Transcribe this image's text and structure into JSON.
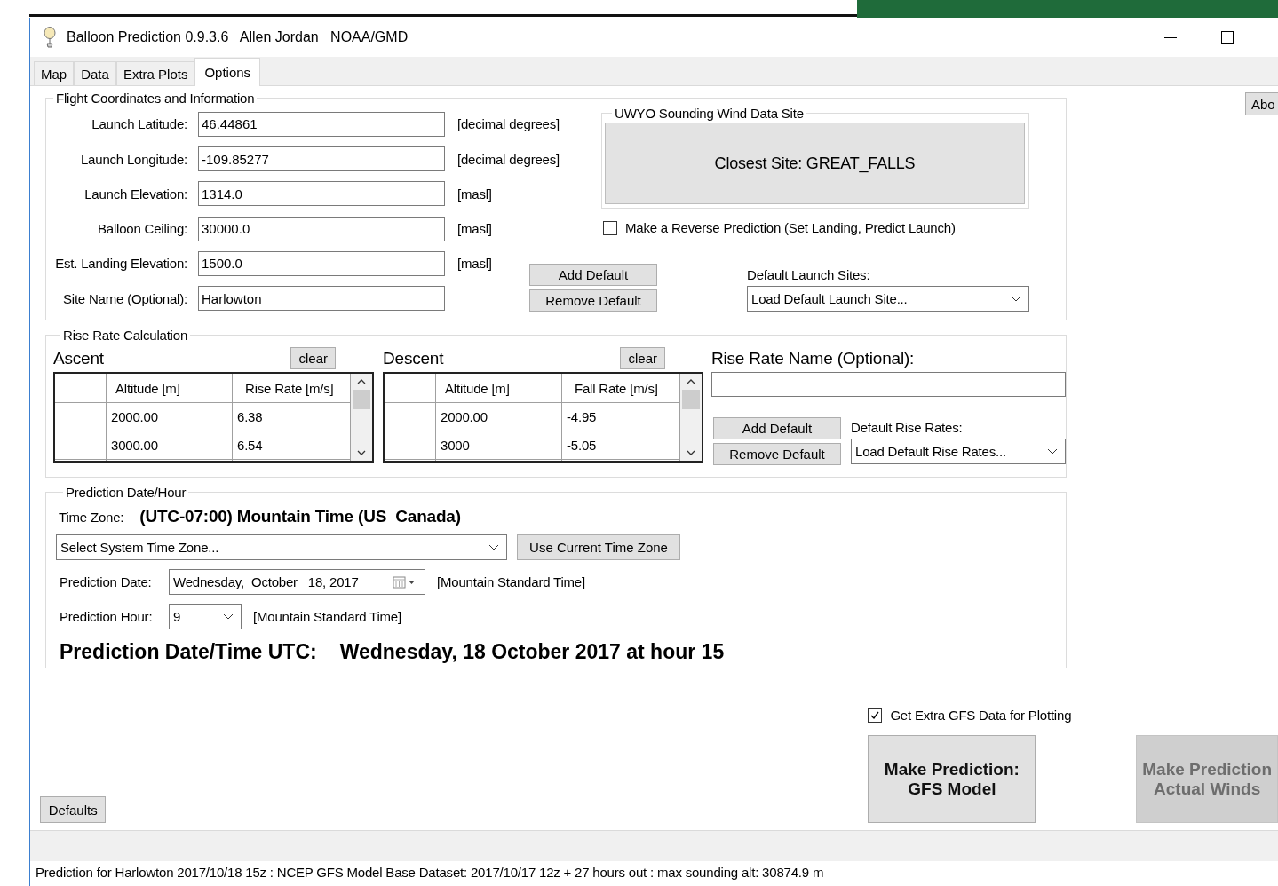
{
  "window": {
    "title": "Balloon Prediction 0.9.3.6   Allen Jordan   NOAA/GMD"
  },
  "tabs": [
    {
      "label": "Map",
      "selected": false
    },
    {
      "label": "Data",
      "selected": false
    },
    {
      "label": "Extra Plots",
      "selected": false
    },
    {
      "label": "Options",
      "selected": true
    }
  ],
  "about_button": "Abo",
  "flight": {
    "title": "Flight Coordinates and Information",
    "fields": [
      {
        "label": "Launch Latitude:",
        "value": "46.44861",
        "unit": "[decimal degrees]"
      },
      {
        "label": "Launch Longitude:",
        "value": "-109.85277",
        "unit": "[decimal degrees]"
      },
      {
        "label": "Launch Elevation:",
        "value": "1314.0",
        "unit": "[masl]"
      },
      {
        "label": "Balloon Ceiling:",
        "value": "30000.0",
        "unit": "[masl]"
      },
      {
        "label": "Est. Landing Elevation:",
        "value": "1500.0",
        "unit": "[masl]"
      },
      {
        "label": "Site Name (Optional):",
        "value": "Harlowton"
      }
    ],
    "add_default": "Add Default",
    "remove_default": "Remove Default",
    "wind_site": {
      "title": "UWYO Sounding Wind Data Site",
      "closest": "Closest Site: GREAT_FALLS"
    },
    "reverse": {
      "label": "Make a Reverse Prediction (Set Landing, Predict Launch)",
      "checked": false
    },
    "launch_sites": {
      "label": "Default Launch Sites:",
      "value": "Load Default Launch Site..."
    }
  },
  "rise_rate": {
    "title": "Rise Rate Calculation",
    "tables": [
      {
        "title": "Ascent",
        "clear": "clear",
        "columns": [
          "Altitude [m]",
          "Rise Rate [m/s]"
        ],
        "rows": [
          [
            "2000.00",
            "6.38"
          ],
          [
            "3000.00",
            "6.54"
          ]
        ]
      },
      {
        "title": "Descent",
        "clear": "clear",
        "columns": [
          "Altitude [m]",
          "Fall Rate [m/s]"
        ],
        "rows": [
          [
            "2000.00",
            "-4.95"
          ],
          [
            "3000",
            "-5.05"
          ]
        ]
      }
    ],
    "name_label": "Rise Rate Name (Optional):",
    "add_default": "Add Default",
    "remove_default": "Remove Default",
    "rise_rates": {
      "label": "Default Rise Rates:",
      "value": "Load Default Rise Rates..."
    }
  },
  "prediction": {
    "title": "Prediction Date/Hour",
    "time_zone_label": "Time Zone:",
    "time_zone": "(UTC-07:00) Mountain Time (US  Canada)",
    "tz_select": "Select System Time Zone...",
    "use_current": "Use Current Time Zone",
    "date_label": "Prediction Date:",
    "date": "Wednesday,  October   18, 2017",
    "date_unit": "[Mountain Standard Time]",
    "hour_label": "Prediction Hour:",
    "hour": "9",
    "hour_unit": "[Mountain Standard Time]",
    "utc_label": "Prediction Date/Time UTC:",
    "utc": "Wednesday, 18 October 2017 at hour 15"
  },
  "extra_gfs": {
    "label": "Get Extra GFS Data for Plotting",
    "checked": true
  },
  "actions": [
    {
      "lines": [
        "Make Prediction:",
        "GFS Model"
      ],
      "disabled": false
    },
    {
      "lines": [
        "Make Prediction",
        "Actual Winds"
      ],
      "disabled": true
    }
  ],
  "defaults_button": "Defaults",
  "status": "Prediction for Harlowton 2017/10/18 15z  :  NCEP GFS Model Base Dataset: 2017/10/17 12z + 27 hours out  :  max sounding alt: 30874.9 m"
}
